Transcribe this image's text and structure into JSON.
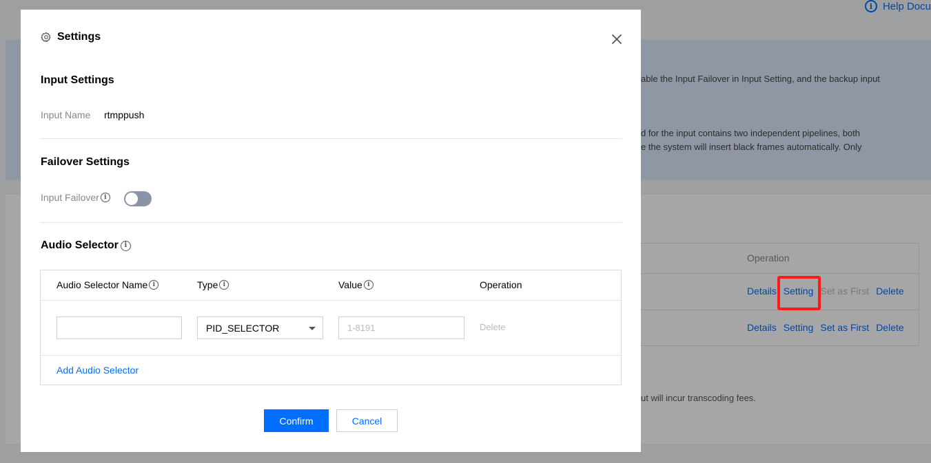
{
  "background": {
    "help_link": "Help Docu",
    "notice": {
      "line1": "able the Input Failover in Input Setting, and the backup input",
      "line2": "d for the input contains two independent pipelines, both",
      "line3": "e the system will insert black frames automatically. Only"
    },
    "table": {
      "operation_header": "Operation",
      "rows": [
        {
          "details": "Details",
          "setting": "Setting",
          "set_first": "Set as First",
          "delete": "Delete"
        },
        {
          "details": "Details",
          "setting": "Setting",
          "set_first": "Set as First",
          "delete": "Delete"
        }
      ]
    },
    "fee_text": "ut will incur transcoding fees.",
    "highlight_color": "#ff1a1a"
  },
  "modal": {
    "title": "Settings",
    "title_icon": "gear-icon",
    "close_icon": "close-icon",
    "input_settings": {
      "title": "Input Settings",
      "name_label": "Input Name",
      "name_value": "rtmppush"
    },
    "failover_settings": {
      "title": "Failover Settings",
      "failover_label": "Input Failover",
      "failover_enabled": false
    },
    "audio_selector": {
      "title": "Audio Selector",
      "columns": {
        "name": "Audio Selector Name",
        "type": "Type",
        "value": "Value",
        "operation": "Operation"
      },
      "rows": [
        {
          "name": "",
          "type": "PID_SELECTOR",
          "value_placeholder": "1-8191",
          "delete": "Delete"
        }
      ],
      "add_label": "Add Audio Selector"
    },
    "confirm_label": "Confirm",
    "cancel_label": "Cancel"
  },
  "colors": {
    "primary": "#006eff",
    "toggle_off": "#8a94a6"
  }
}
